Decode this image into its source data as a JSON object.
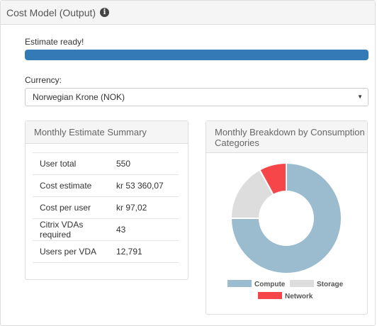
{
  "panel": {
    "title": "Cost Model (Output)",
    "info_icon": "i"
  },
  "status": {
    "text": "Estimate ready!",
    "progress_percent": 100,
    "bar_color": "#337ab7"
  },
  "currency": {
    "label": "Currency:",
    "selected": "Norwegian Krone (NOK)"
  },
  "summary": {
    "title": "Monthly Estimate Summary",
    "rows": [
      {
        "label": "User total",
        "value": "550"
      },
      {
        "label": "Cost estimate",
        "value": "kr 53 360,07"
      },
      {
        "label": "Cost per user",
        "value": "kr 97,02"
      },
      {
        "label": "Citrix VDAs required",
        "value": "43"
      },
      {
        "label": "Users per VDA",
        "value": "12,791"
      }
    ]
  },
  "breakdown": {
    "title": "Monthly Breakdown by Consumption Categories"
  },
  "chart_data": {
    "type": "pie",
    "donut": true,
    "series": [
      {
        "name": "Compute",
        "value": 75,
        "color": "#9bbbcf"
      },
      {
        "name": "Storage",
        "value": 17,
        "color": "#dddddd"
      },
      {
        "name": "Network",
        "value": 8,
        "color": "#f7464a"
      }
    ],
    "legend": "bottom"
  }
}
